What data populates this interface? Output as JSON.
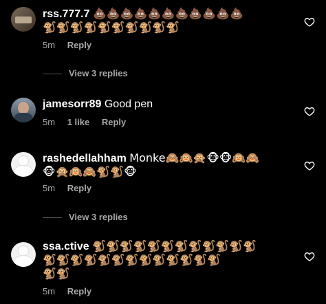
{
  "comments": [
    {
      "username": "rss.777.7",
      "text_line1": "💩💩💩💩💩💩💩💩💩💩💩",
      "text_line2": "🐒🐒🐒🐒🐒🐒🐒🐒🐒🐒",
      "time": "5m",
      "likes": "",
      "reply_label": "Reply"
    },
    {
      "username": "jamesorr89",
      "text_line1": "Good pen",
      "text_line2": "",
      "time": "5m",
      "likes": "1 like",
      "reply_label": "Reply"
    },
    {
      "username": "rashedellahham",
      "text_line1": "Monke🙈🙉🙊🐵🐵🙉🙈",
      "text_line2": "🐵🙊🙉🙈🐒🐒🐵",
      "time": "5m",
      "likes": "",
      "reply_label": "Reply"
    },
    {
      "username": "ssa.ctive",
      "text_line1": "🐒🐒🐒🐒🐒🐒🐒🐒🐒🐒🐒🐒",
      "text_line2": "🐒🐒🐒🐒🐒🐒🐒🐒🐒🐒🐒🐒🐒",
      "text_line3": "🐒🐒",
      "time": "5m",
      "likes": "",
      "reply_label": "Reply"
    }
  ],
  "view_replies": [
    {
      "label": "View 3 replies"
    },
    {
      "label": "View 3 replies"
    }
  ],
  "colors": {
    "background": "#000000",
    "text": "#ffffff",
    "secondary": "#a8a8a8"
  },
  "icons": {
    "like": "heart-outline-icon"
  }
}
